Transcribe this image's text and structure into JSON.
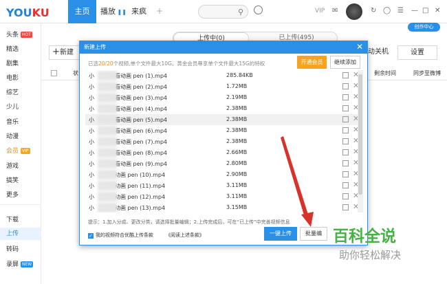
{
  "header": {
    "logo_main": "YOU",
    "logo_accent": "KU",
    "tabs": [
      "主页",
      "播放",
      "来疯"
    ],
    "vip": "VIP"
  },
  "sidebar": {
    "items": [
      "头条",
      "精选",
      "剧集",
      "电影",
      "综艺",
      "少儿",
      "音乐",
      "动漫",
      "会员",
      "游戏",
      "搞笑",
      "更多",
      "下载",
      "上传",
      "转码",
      "录屏"
    ],
    "badges": {
      "hot": "HOT",
      "vip": "VIP",
      "new": "NEW"
    }
  },
  "upload_page": {
    "creator_btn": "创作中心",
    "tab_uploading": "上传中(0)",
    "tab_uploaded": "已上传(495)",
    "new_btn": "新建",
    "auto_shutdown": "自动关机",
    "settings": "设置",
    "col_name": "状",
    "col_remaining": "剩余时间",
    "col_sync": "同步至微博"
  },
  "dialog": {
    "title": "新建上传",
    "info_prefix": "已选",
    "info_count": "20/20",
    "info_rest": "个视频,单个文件最大10G。黄金会员尊享单个文件最大15G的特权",
    "gold_btn": "开通会员",
    "continue_btn": "继续添加",
    "files": [
      {
        "name_pre": "小",
        "name_post": "看动画 pen (1).mp4",
        "size": "285.84KB"
      },
      {
        "name_pre": "小",
        "name_post": "看动画 pen (2).mp4",
        "size": "1.72MB"
      },
      {
        "name_pre": "小",
        "name_post": "看动画 pen (3).mp4",
        "size": "2.19MB"
      },
      {
        "name_pre": "小",
        "name_post": "看动画 pen (4).mp4",
        "size": "2.38MB"
      },
      {
        "name_pre": "小",
        "name_post": "看动画 pen (5).mp4",
        "size": "2.38MB"
      },
      {
        "name_pre": "小",
        "name_post": "看动画 pen (6).mp4",
        "size": "2.38MB"
      },
      {
        "name_pre": "小",
        "name_post": "看动画 pen (7).mp4",
        "size": "2.38MB"
      },
      {
        "name_pre": "小",
        "name_post": "看动画 pen (8).mp4",
        "size": "2.66MB"
      },
      {
        "name_pre": "小",
        "name_post": "看动画 pen (9).mp4",
        "size": "2.80MB"
      },
      {
        "name_pre": "小",
        "name_post": "动画 pen (10).mp4",
        "size": "2.90MB"
      },
      {
        "name_pre": "小",
        "name_post": "动画 pen (11).mp4",
        "size": "3.11MB"
      },
      {
        "name_pre": "小",
        "name_post": "动画 pen (12).mp4",
        "size": "3.11MB"
      },
      {
        "name_pre": "小",
        "name_post": "动画 pen (13).mp4",
        "size": "3.15MB"
      }
    ],
    "tip": "提示：1.加入分成、更改分类，请选择批量编辑；2.上传完成后，可在“已上传”中完善视频信息",
    "agree": "我的视频符合优酷上传条款",
    "terms": "《阅读上述条款》",
    "upload_btn": "一键上传",
    "batch_btn": "批量编"
  },
  "watermark": {
    "title": "百科全说",
    "subtitle": "助你轻松解决"
  }
}
